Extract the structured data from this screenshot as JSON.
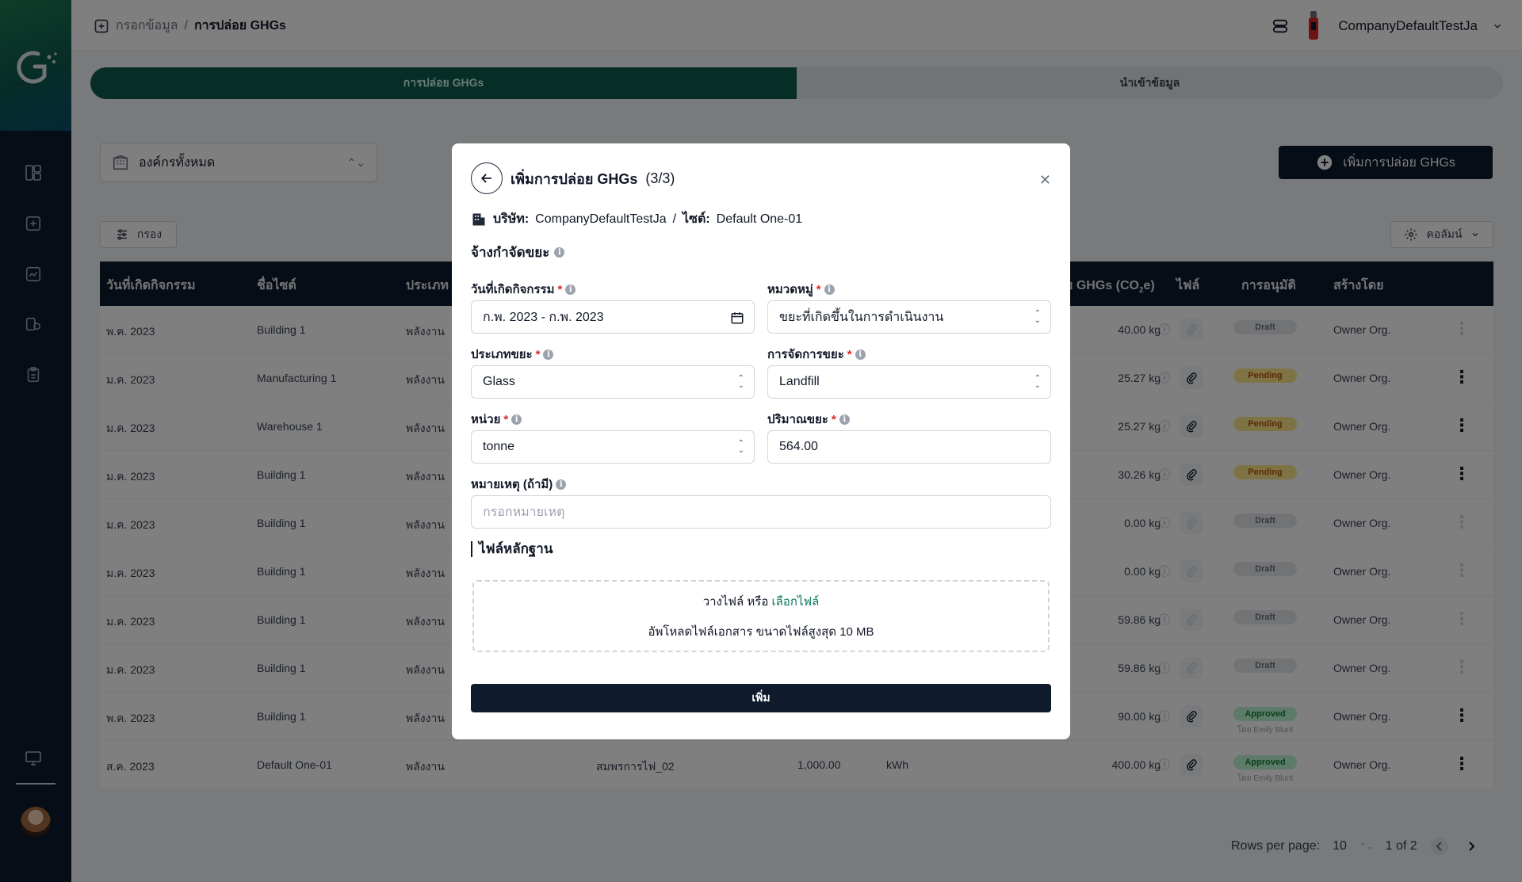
{
  "breadcrumb": {
    "parent": "กรอกข้อมูล",
    "separator": "/",
    "current": "การปล่อย GHGs"
  },
  "user": {
    "company": "CompanyDefaultTestJa"
  },
  "tabs": [
    {
      "label": "การปล่อย GHGs",
      "active": true
    },
    {
      "label": "นำเข้าข้อมูล",
      "active": false
    }
  ],
  "org_select": {
    "value": "องค์กรทั้งหมด"
  },
  "add_button": {
    "label": "เพิ่มการปล่อย GHGs"
  },
  "filter_button": {
    "label": "กรอง"
  },
  "columns_button": {
    "label": "คอลัมน์"
  },
  "table": {
    "headers": {
      "date": "วันที่เกิดกิจกรรม",
      "site": "ชื่อไซต์",
      "type": "ประเภท",
      "emission_prefix": "ย GHGs (CO",
      "emission_sub": "2",
      "emission_suffix": "e)",
      "file": "ไฟล์",
      "approval": "การอนุมัติ",
      "created_by": "สร้างโดย"
    },
    "rows": [
      {
        "date": "พ.ค. 2023",
        "site": "Building 1",
        "type": "พลังงาน",
        "source": "",
        "qty": "",
        "unit": "",
        "emission": "40.00 kg",
        "status": "Draft",
        "status_class": "draft",
        "approver": "",
        "created_by": "Owner Org.",
        "kebab_active": false
      },
      {
        "date": "ม.ค. 2023",
        "site": "Manufacturing 1",
        "type": "พลังงาน",
        "source": "",
        "qty": "",
        "unit": "",
        "emission": "25.27 kg",
        "status": "Pending",
        "status_class": "pending",
        "approver": "",
        "created_by": "Owner Org.",
        "kebab_active": true
      },
      {
        "date": "ม.ค. 2023",
        "site": "Warehouse 1",
        "type": "พลังงาน",
        "source": "",
        "qty": "",
        "unit": "",
        "emission": "25.27 kg",
        "status": "Pending",
        "status_class": "pending",
        "approver": "",
        "created_by": "Owner Org.",
        "kebab_active": true
      },
      {
        "date": "ม.ค. 2023",
        "site": "Building 1",
        "type": "พลังงาน",
        "source": "",
        "qty": "",
        "unit": "",
        "emission": "30.26 kg",
        "status": "Pending",
        "status_class": "pending",
        "approver": "",
        "created_by": "Owner Org.",
        "kebab_active": true
      },
      {
        "date": "ม.ค. 2023",
        "site": "Building 1",
        "type": "พลังงาน",
        "source": "",
        "qty": "",
        "unit": "",
        "emission": "0.00 kg",
        "status": "Draft",
        "status_class": "draft",
        "approver": "",
        "created_by": "Owner Org.",
        "kebab_active": false
      },
      {
        "date": "ม.ค. 2023",
        "site": "Building 1",
        "type": "พลังงาน",
        "source": "",
        "qty": "",
        "unit": "",
        "emission": "0.00 kg",
        "status": "Draft",
        "status_class": "draft",
        "approver": "",
        "created_by": "Owner Org.",
        "kebab_active": false
      },
      {
        "date": "ม.ค. 2023",
        "site": "Building 1",
        "type": "พลังงาน",
        "source": "",
        "qty": "",
        "unit": "",
        "emission": "59.86 kg",
        "status": "Draft",
        "status_class": "draft",
        "approver": "",
        "created_by": "Owner Org.",
        "kebab_active": false
      },
      {
        "date": "ม.ค. 2023",
        "site": "Building 1",
        "type": "พลังงาน",
        "source": "",
        "qty": "",
        "unit": "",
        "emission": "59.86 kg",
        "status": "Draft",
        "status_class": "draft",
        "approver": "",
        "created_by": "Owner Org.",
        "kebab_active": false
      },
      {
        "date": "พ.ค. 2023",
        "site": "Building 1",
        "type": "พลังงาน",
        "source": "",
        "qty": "",
        "unit": "",
        "emission": "90.00 kg",
        "status": "Approved",
        "status_class": "approved",
        "approver": "โดย Emily Blunt",
        "created_by": "Owner Org.",
        "kebab_active": true
      },
      {
        "date": "ส.ค. 2023",
        "site": "Default One-01",
        "type": "พลังงาน",
        "source": "สมพรการไฟ_02",
        "qty": "1,000.00",
        "unit": "kWh",
        "emission": "400.00 kg",
        "status": "Approved",
        "status_class": "approved",
        "approver": "โดย Emily Blunt",
        "created_by": "Owner Org.",
        "kebab_active": true
      }
    ]
  },
  "pagination": {
    "rows_label": "Rows per page:",
    "rows_value": "10",
    "range": "1 of 2"
  },
  "modal": {
    "title": "เพิ่มการปล่อย GHGs",
    "step": "(3/3)",
    "company_label": "บริษัท:",
    "company_value": "CompanyDefaultTestJa",
    "site_label": "ไซต์:",
    "site_value": "Default One-01",
    "section_title": "จ้างกำจัดขยะ",
    "fields": {
      "date": {
        "label": "วันที่เกิดกิจกรรม",
        "value": "ก.พ. 2023 - ก.พ. 2023"
      },
      "category": {
        "label": "หมวดหมู่",
        "value": "ขยะที่เกิดขึ้นในการดำเนินงาน"
      },
      "waste_type": {
        "label": "ประเภทขยะ",
        "value": "Glass"
      },
      "disposal": {
        "label": "การจัดการขยะ",
        "value": "Landfill"
      },
      "unit": {
        "label": "หน่วย",
        "value": "tonne"
      },
      "amount": {
        "label": "ปริมาณขยะ",
        "value": "564.00"
      },
      "note": {
        "label": "หมายเหตุ (ถ้ามี)",
        "placeholder": "กรอกหมายเหตุ"
      }
    },
    "evidence_title": "ไฟล์หลักฐาน",
    "dropzone": {
      "text": "วางไฟล์ หรือ",
      "link": "เลือกไฟล์",
      "hint": "อัพโหลดไฟล์เอกสาร ขนาดไฟล์สูงสุด 10 MB"
    },
    "submit_label": "เพิ่ม"
  },
  "colors": {
    "navy": "#0f1b2d",
    "green": "#0e5a4e",
    "required": "#dc2626",
    "link": "#0e7a5f"
  }
}
